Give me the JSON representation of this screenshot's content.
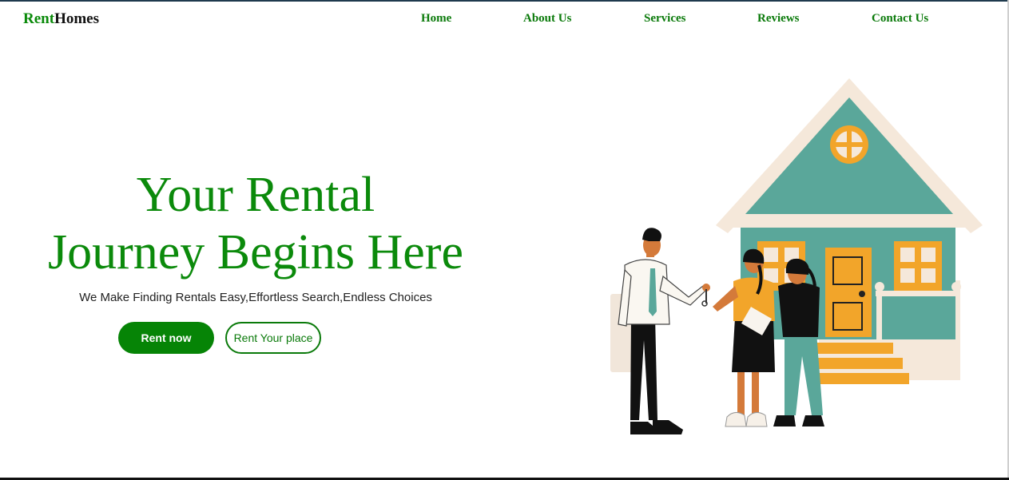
{
  "brand": {
    "part1": "Rent",
    "part2": "Homes"
  },
  "nav": {
    "home": "Home",
    "about": "About Us",
    "services": "Services",
    "reviews": "Reviews",
    "contact": "Contact Us"
  },
  "hero": {
    "title_line1": "Your Rental",
    "title_line2": "Journey Begins Here",
    "subtitle": "We Make Finding Rentals Easy,Effortless Search,Endless Choices",
    "primary_button": "Rent now",
    "secondary_button": "Rent Your place"
  },
  "colors": {
    "brand_green": "#0b8a0b",
    "button_green": "#068406",
    "house_teal": "#5aa79a",
    "house_orange": "#f2a52a",
    "house_cream": "#f5e8da"
  }
}
